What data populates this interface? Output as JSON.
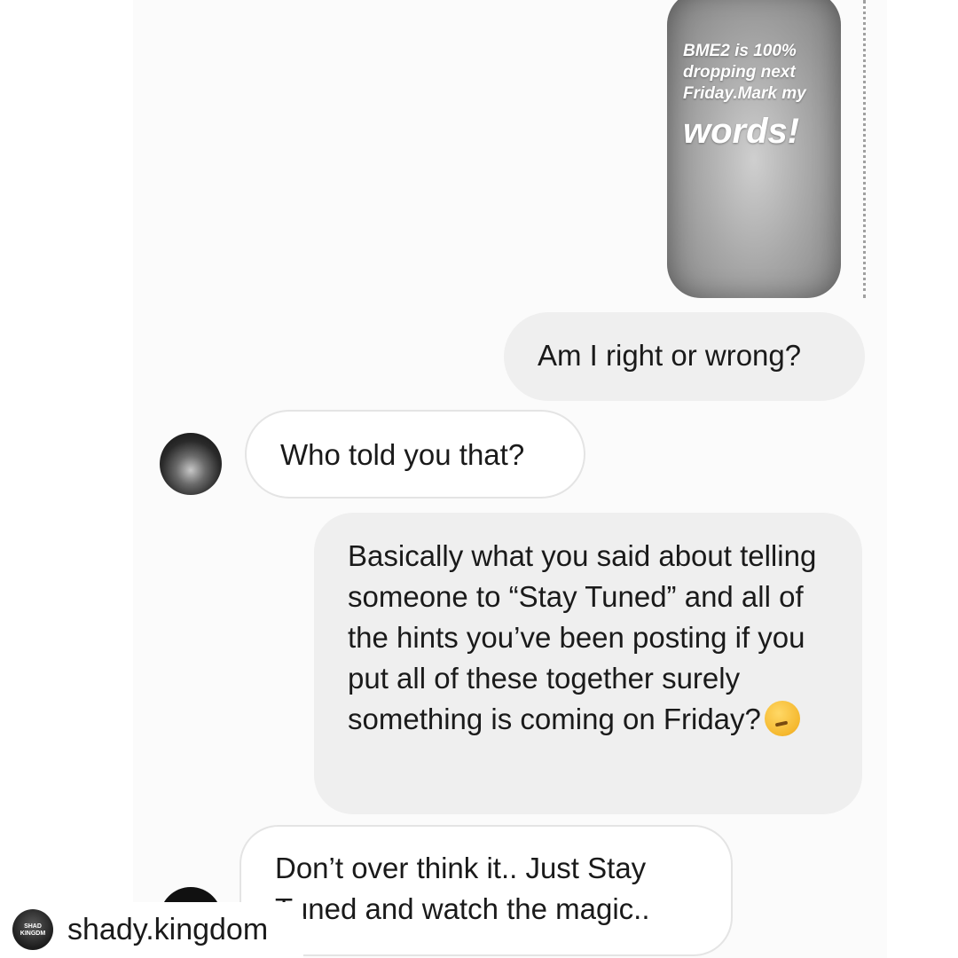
{
  "story": {
    "text_line1": "BME2 is 100% dropping next Friday.Mark my",
    "text_line2": "words!"
  },
  "messages": [
    {
      "from": "me",
      "text": "Am I right or wrong?"
    },
    {
      "from": "them",
      "text": "Who told you that?"
    },
    {
      "from": "me",
      "text": "Basically what you said about telling someone to “Stay Tuned” and all of the hints you’ve been posting if you put all of these together surely something is coming on Friday?",
      "emoji": "thinking-face"
    },
    {
      "from": "them",
      "text": "Don’t over think it.. Just Stay Tuned and watch the magic.."
    }
  ],
  "repost_credit": {
    "username": "shady.kingdom",
    "avatar_text": "SHAD KINGDM"
  }
}
